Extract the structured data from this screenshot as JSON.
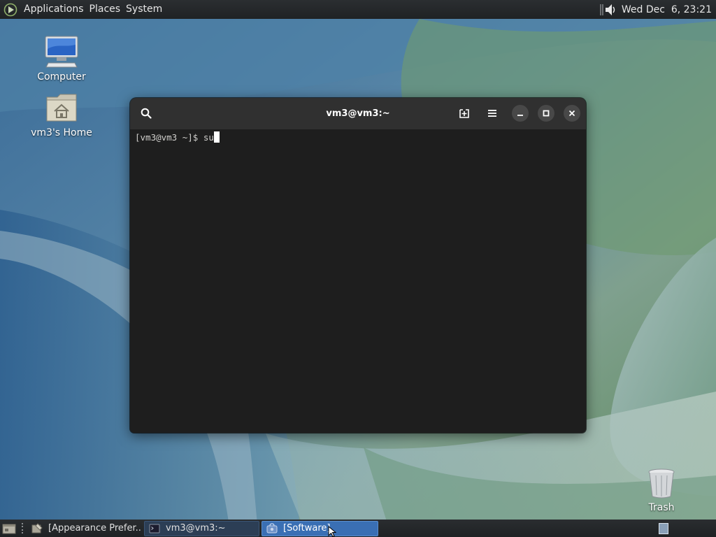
{
  "top_panel": {
    "menus": [
      "Applications",
      "Places",
      "System"
    ],
    "clock": "Wed Dec  6, 23:21",
    "icons": {
      "logo": "gnome-foot-icon",
      "volume": "speaker-icon"
    }
  },
  "desktop": {
    "icons": [
      {
        "label": "Computer",
        "icon": "computer-icon"
      },
      {
        "label": "vm3's Home",
        "icon": "home-folder-icon"
      },
      {
        "label": "Trash",
        "icon": "trash-icon"
      }
    ]
  },
  "terminal": {
    "title": "vm3@vm3:~",
    "prompt": "[vm3@vm3 ~]$ su",
    "buttons": [
      "search",
      "new-tab",
      "menu",
      "minimize",
      "maximize",
      "close"
    ]
  },
  "taskbar": {
    "tasks": [
      {
        "label": "[Appearance Prefer...",
        "state": "normal",
        "icon": "appearance-icon"
      },
      {
        "label": "vm3@vm3:~",
        "state": "inactive",
        "icon": "terminal-icon"
      },
      {
        "label": "[Software]",
        "state": "active",
        "icon": "software-icon"
      }
    ]
  },
  "colors": {
    "panel": "#1f2224",
    "terminal_bg": "#1e1e1e",
    "terminal_header": "#303030",
    "active_task": "#3a6fb4"
  }
}
